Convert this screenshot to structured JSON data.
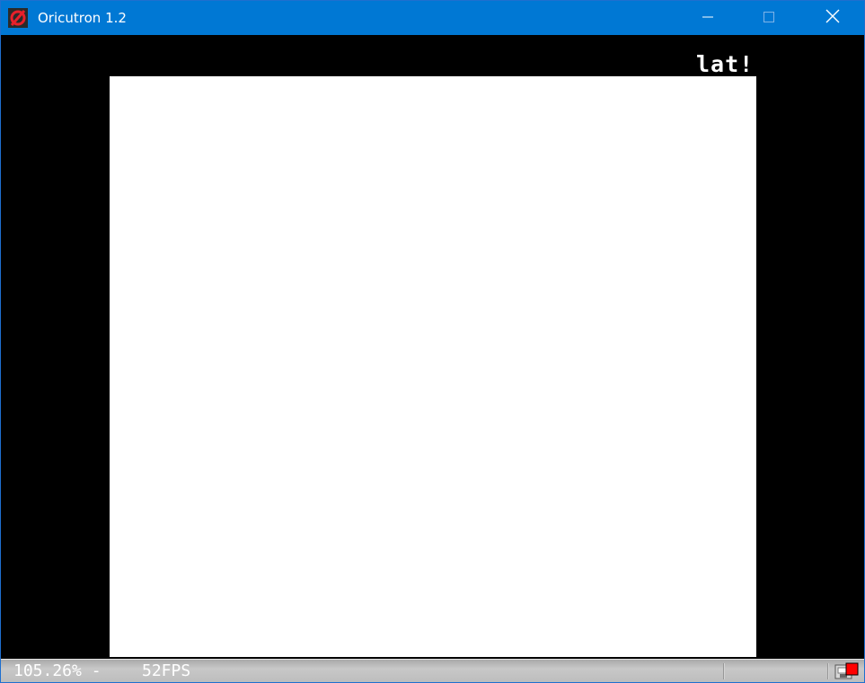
{
  "window": {
    "title": "Oricutron 1.2",
    "icon": "oricutron-logo-icon",
    "controls": {
      "minimize": "minimize-icon",
      "maximize": "maximize-icon",
      "close": "close-icon"
    },
    "titlebar_color": "#0078d4"
  },
  "emulator": {
    "status_text": "lat!",
    "display_background": "#ffffff",
    "border_background": "#000000"
  },
  "statusbar": {
    "speed": "105.26% -",
    "fps": "52FPS",
    "drive_icon": "disk-activity-icon",
    "activity_color": "#ff0000"
  }
}
